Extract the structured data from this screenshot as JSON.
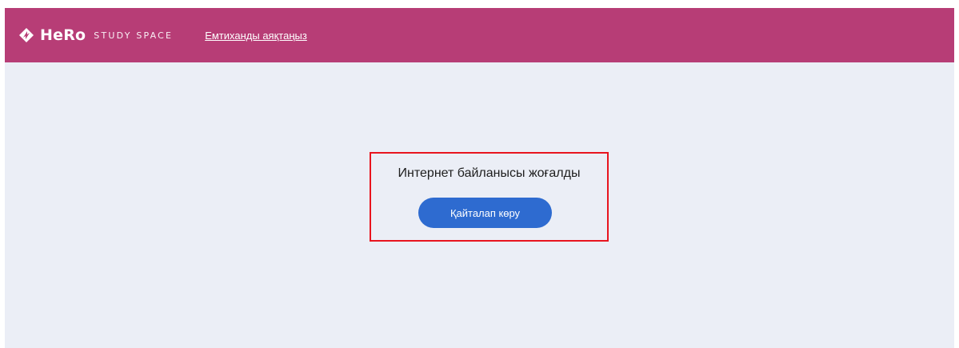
{
  "header": {
    "logo_icon": "hero-logo-icon",
    "logo_name": "HeRo",
    "logo_sub": "STUDY SPACE",
    "exam_link": "Емтиханды аяқтаңыз"
  },
  "main": {
    "message": "Интернет байланысы жоғалды",
    "retry_label": "Қайталап көру"
  },
  "colors": {
    "header_bg": "#b73d76",
    "page_bg": "#ebeef6",
    "button_bg": "#2e6bd0",
    "highlight_border": "#e8141e"
  }
}
